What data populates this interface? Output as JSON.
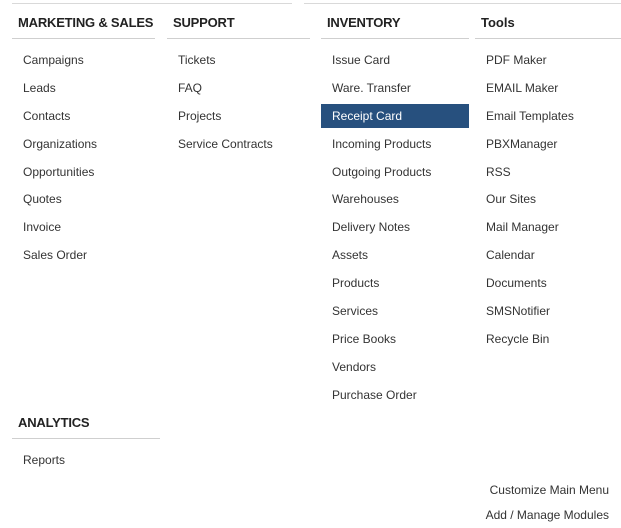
{
  "marketing": {
    "header": "MARKETING & SALES",
    "items": [
      "Campaigns",
      "Leads",
      "Contacts",
      "Organizations",
      "Opportunities",
      "Quotes",
      "Invoice",
      "Sales Order"
    ]
  },
  "support": {
    "header": "SUPPORT",
    "items": [
      "Tickets",
      "FAQ",
      "Projects",
      "Service Contracts"
    ]
  },
  "inventory": {
    "header": "INVENTORY",
    "items": [
      "Issue Card",
      "Ware. Transfer",
      "Receipt Card",
      "Incoming Products",
      "Outgoing Products",
      "Warehouses",
      "Delivery Notes",
      "Assets",
      "Products",
      "Services",
      "Price Books",
      "Vendors",
      "Purchase Order"
    ],
    "active_item": "Receipt Card"
  },
  "tools": {
    "header": "Tools",
    "items": [
      "PDF Maker",
      "EMAIL Maker",
      "Email Templates",
      "PBXManager",
      "RSS",
      "Our Sites",
      "Mail Manager",
      "Calendar",
      "Documents",
      "SMSNotifier",
      "Recycle Bin"
    ]
  },
  "analytics": {
    "header": "ANALYTICS",
    "items": [
      "Reports"
    ]
  },
  "footer": {
    "customize_label": "Customize Main Menu",
    "manage_label": "Add / Manage Modules"
  },
  "colors": {
    "active_bg": "#27507e",
    "active_text": "#ffffff",
    "text": "#333333",
    "divider": "#cfcfcf"
  }
}
